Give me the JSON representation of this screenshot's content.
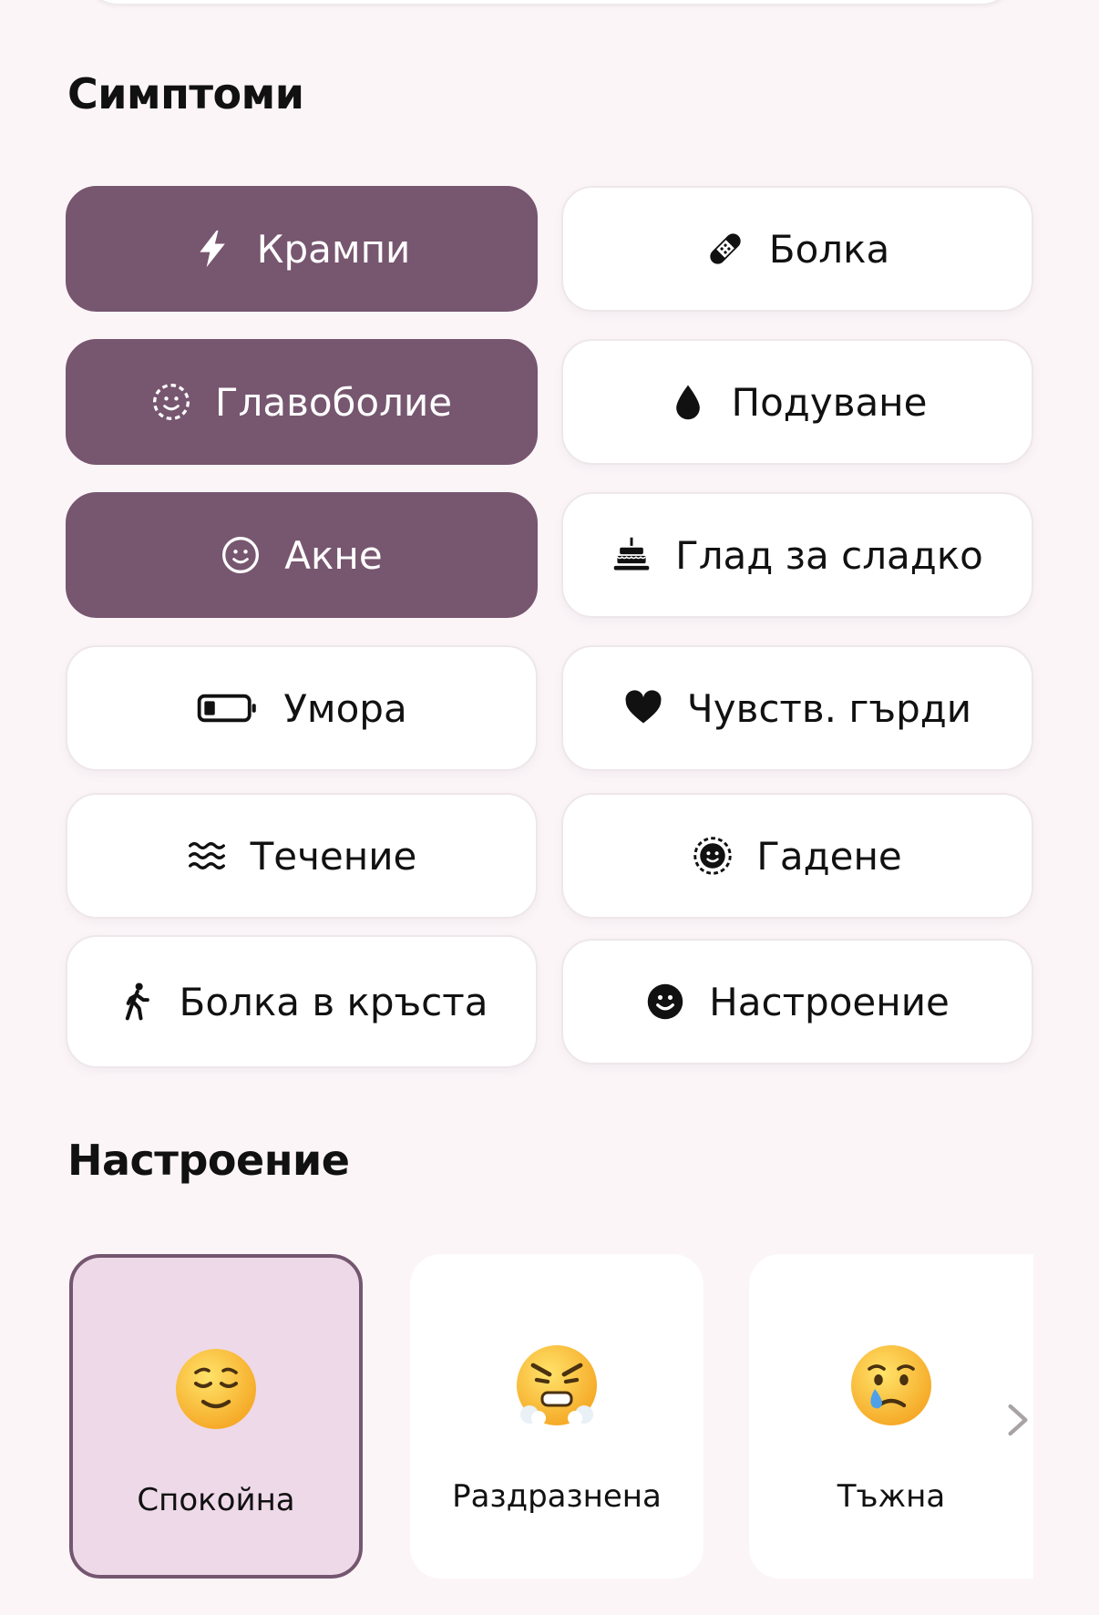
{
  "symptoms": {
    "title": "Симптоми",
    "items": [
      {
        "label": "Крампи",
        "icon": "lightning-icon",
        "selected": true
      },
      {
        "label": "Болка",
        "icon": "bandage-icon",
        "selected": false
      },
      {
        "label": "Главоболие",
        "icon": "dashed-face-icon",
        "selected": true
      },
      {
        "label": "Подуване",
        "icon": "drop-icon",
        "selected": false
      },
      {
        "label": "Акне",
        "icon": "smiley-outline-icon",
        "selected": true
      },
      {
        "label": "Глад за сладко",
        "icon": "cake-icon",
        "selected": false
      },
      {
        "label": "Умора",
        "icon": "battery-low-icon",
        "selected": false
      },
      {
        "label": "Чувств. гърди",
        "icon": "heart-icon",
        "selected": false
      },
      {
        "label": "Течение",
        "icon": "waves-icon",
        "selected": false
      },
      {
        "label": "Гадене",
        "icon": "dizzy-face-icon",
        "selected": false
      },
      {
        "label": "Болка в кръста",
        "icon": "walking-figure-icon",
        "selected": false
      },
      {
        "label": "Настроение",
        "icon": "smiley-filled-icon",
        "selected": false
      }
    ]
  },
  "mood": {
    "title": "Настроение",
    "items": [
      {
        "label": "Спокойна",
        "icon": "relieved-face-emoji",
        "selected": true
      },
      {
        "label": "Раздразнена",
        "icon": "angry-steam-face-emoji",
        "selected": false
      },
      {
        "label": "Тъжна",
        "icon": "crying-face-emoji",
        "selected": false
      }
    ]
  },
  "colors": {
    "selected_chip": "#77566f",
    "selected_mood_bg": "#eed9e9",
    "background": "#fbf5f8"
  }
}
